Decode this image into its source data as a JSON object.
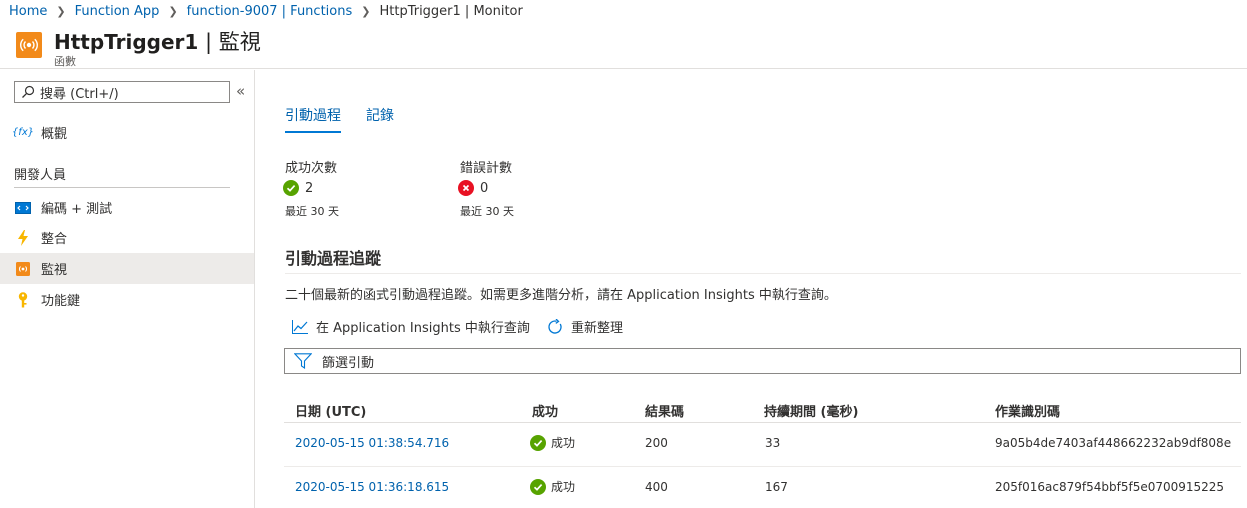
{
  "breadcrumb": {
    "items": [
      "Home",
      "Function App",
      "function-9007 | Functions"
    ],
    "current": "HttpTrigger1 | Monitor"
  },
  "header": {
    "title_name": "HttpTrigger1",
    "title_sep": " | ",
    "title_page": "監視",
    "subtitle": "函數"
  },
  "sidebar": {
    "search_placeholder": "搜尋 (Ctrl+/)",
    "collapse_glyph": "«",
    "overview_label": "概觀",
    "section_label": "開發人員",
    "items": [
      {
        "label": "編碼 + 測試",
        "icon": "code-test-icon"
      },
      {
        "label": "整合",
        "icon": "lightning-icon"
      },
      {
        "label": "監視",
        "icon": "monitor-icon"
      },
      {
        "label": "功能鍵",
        "icon": "key-icon"
      }
    ]
  },
  "main": {
    "tabs": [
      "引動過程",
      "記錄"
    ],
    "metrics": [
      {
        "label": "成功次數",
        "value": "2",
        "sub": "最近 30 天",
        "status": "success"
      },
      {
        "label": "錯誤計數",
        "value": "0",
        "sub": "最近 30 天",
        "status": "error"
      }
    ],
    "section_title": "引動過程追蹤",
    "description": "二十個最新的函式引動過程追蹤。如需更多進階分析，請在 Application Insights 中執行查詢。",
    "commands": {
      "run_query": "在 Application Insights 中執行查詢",
      "refresh": "重新整理"
    },
    "filter_placeholder": "篩選引動",
    "table": {
      "columns": [
        "日期 (UTC)",
        "成功",
        "結果碼",
        "持續期間 (毫秒)",
        "作業識別碼"
      ],
      "rows": [
        {
          "date": "2020-05-15 01:38:54.716",
          "status": "成功",
          "code": "200",
          "duration": "33",
          "op_id": "9a05b4de7403af448662232ab9df808e"
        },
        {
          "date": "2020-05-15 01:36:18.615",
          "status": "成功",
          "code": "400",
          "duration": "167",
          "op_id": "205f016ac879f54bbf5f5e0700915225"
        }
      ]
    }
  },
  "colors": {
    "link": "#0062ad",
    "accent": "#0078d4",
    "success": "#57a300",
    "error": "#e81123",
    "app_icon": "#f28a1a"
  }
}
